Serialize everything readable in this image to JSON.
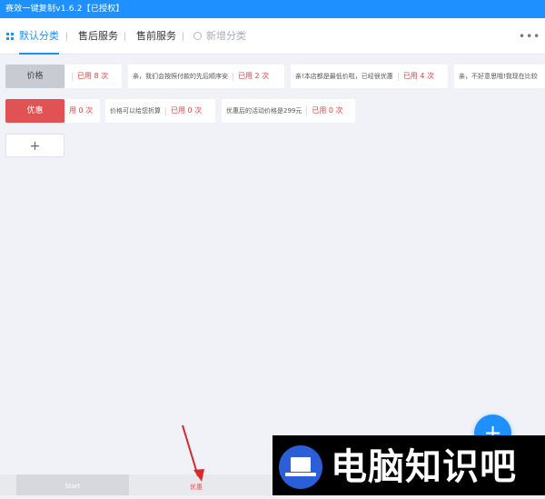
{
  "window": {
    "title": "赛效一键复制v1.6.2【已授权】"
  },
  "tabs": [
    {
      "label": "默认分类"
    },
    {
      "label": "售后服务"
    },
    {
      "label": "售前服务"
    }
  ],
  "new_category_label": "新增分类",
  "more_label": "•••",
  "rows": [
    {
      "label": "价格",
      "cards": [
        {
          "text": "",
          "used": "已用 8 次"
        },
        {
          "text": "亲，我们会按照付款的先后顺序安",
          "used": "已用 2 次"
        },
        {
          "text": "亲!本店都是最低价啦，已经很优惠",
          "used": "已用 4 次"
        },
        {
          "text": "亲，不好意思哦!我现在比较"
        }
      ]
    },
    {
      "label": "优惠",
      "cards": [
        {
          "text": "",
          "used": "用 0 次"
        },
        {
          "text": "价格可以给您折算",
          "used": "已用 0 次"
        },
        {
          "text": "优惠后的活动价格是299元",
          "used": "已用 0 次"
        }
      ]
    }
  ],
  "add_row_label": "+",
  "fab_label": "+",
  "bottom": {
    "start_label": "Start",
    "active_label": "优惠"
  },
  "watermark": {
    "text": "电脑知识吧"
  },
  "colors": {
    "accent": "#1e90ff",
    "danger": "#e05254"
  }
}
